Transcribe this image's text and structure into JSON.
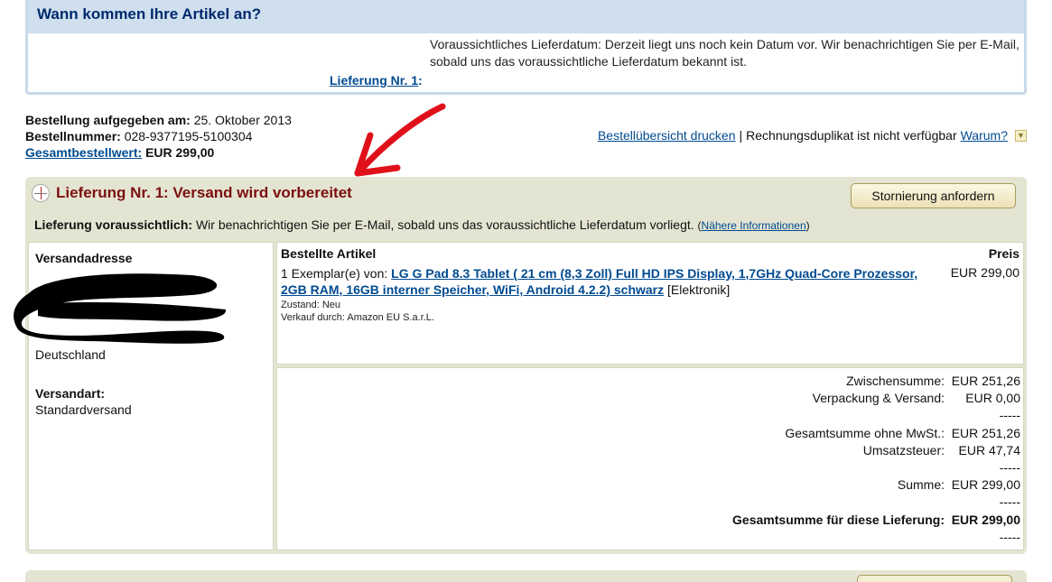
{
  "arrival": {
    "title": "Wann kommen Ihre Artikel an?",
    "text": "Voraussichtliches Lieferdatum: Derzeit liegt uns noch kein Datum vor. Wir benachrichtigen Sie per E-Mail, sobald uns das voraussichtliche Lieferdatum bekannt ist.",
    "shipment_link": "Lieferung Nr. 1",
    "shipment_link_suffix": ":"
  },
  "order": {
    "placed_label": "Bestellung aufgegeben am:",
    "placed_value": "25. Oktober 2013",
    "number_label": "Bestellnummer:",
    "number_value": "028-9377195-5100304",
    "total_label": "Gesamtbestellwert:",
    "total_value": "EUR 299,00"
  },
  "actions": {
    "print_link": "Bestellübersicht drucken",
    "separator": "|",
    "invoice_text": "Rechnungsduplikat ist nicht verfügbar",
    "why_link": "Warum?"
  },
  "shipment": {
    "title": "Lieferung Nr. 1: Versand wird vorbereitet",
    "cancel_button": "Stornierung anfordern",
    "estimate_label": "Lieferung voraussichtlich:",
    "estimate_text": "Wir benachrichtigen Sie per E-Mail, sobald uns das voraussichtliche Lieferdatum vorliegt.",
    "more_info_open": "(",
    "more_info_link": "Nähere Informationen",
    "more_info_close": ")",
    "address_label": "Versandadresse",
    "country": "Deutschland",
    "ship_method_label": "Versandart:",
    "ship_method_value": "Standardversand",
    "items_header": "Bestellte Artikel",
    "price_header": "Preis",
    "item_qty": "1 Exemplar(e) von:",
    "item_title": "LG G Pad 8.3 Tablet ( 21 cm (8,3 Zoll) Full HD IPS Display, 1,7GHz Quad-Core Prozessor, 2GB RAM, 16GB interner Speicher, WiFi, Android 4.2.2) schwarz",
    "item_category": "[Elektronik]",
    "item_condition": "Zustand: Neu",
    "item_seller": "Verkauf durch: Amazon EU S.a.r.L.",
    "item_price": "EUR 299,00"
  },
  "totals": {
    "subtotal_label": "Zwischensumme:",
    "subtotal_value": "EUR 251,26",
    "shipping_label": "Verpackung & Versand:",
    "shipping_value": "EUR 0,00",
    "net_label": "Gesamtsumme ohne MwSt.:",
    "net_value": "EUR 251,26",
    "vat_label": "Umsatzsteuer:",
    "vat_value": "EUR 47,74",
    "sum_label": "Summe:",
    "sum_value": "EUR 299,00",
    "grand_label": "Gesamtsumme für diese Lieferung:",
    "grand_value": "EUR 299,00",
    "dashes": "-----"
  },
  "colors": {
    "link": "#004b91",
    "shipment_title": "#7b1010",
    "panel_bg": "#e4e4d2",
    "header_bg": "#cfdfee",
    "annotation_arrow": "#e0101a"
  }
}
